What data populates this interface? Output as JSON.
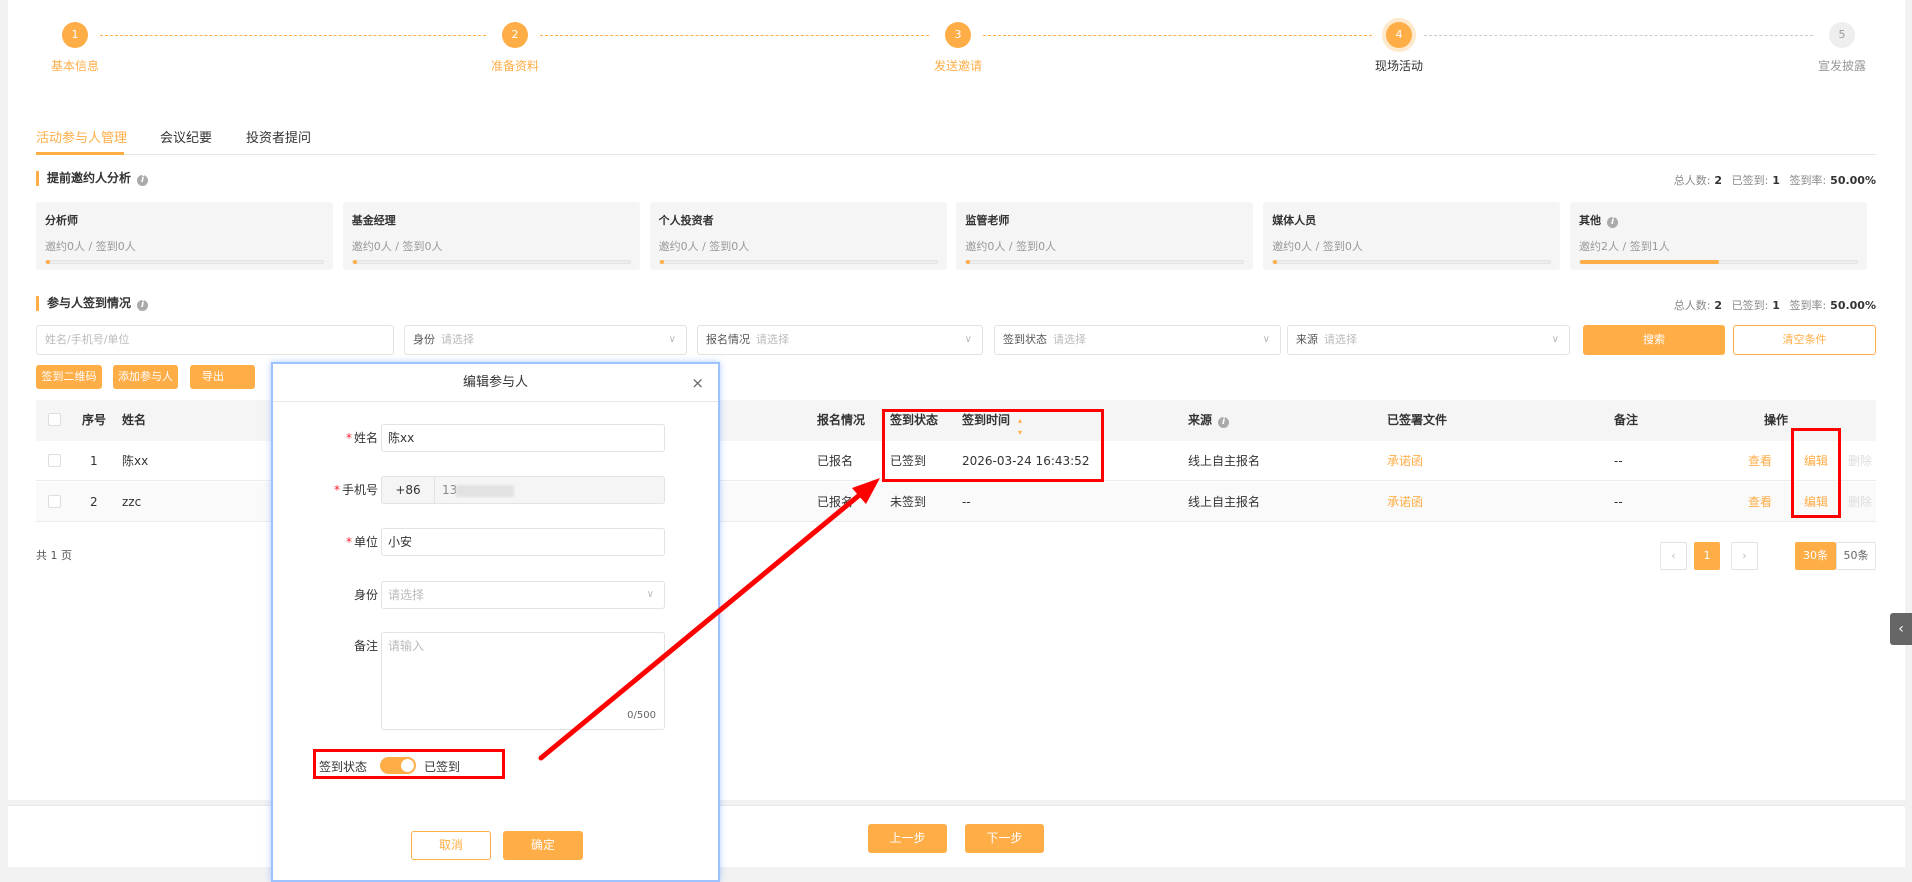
{
  "steps": [
    {
      "num": "1",
      "label": "基本信息",
      "state": "done"
    },
    {
      "num": "2",
      "label": "准备资料",
      "state": "done"
    },
    {
      "num": "3",
      "label": "发送邀请",
      "state": "done"
    },
    {
      "num": "4",
      "label": "现场活动",
      "state": "current"
    },
    {
      "num": "5",
      "label": "宣发披露",
      "state": "todo"
    }
  ],
  "tabs": [
    {
      "label": "活动参与人管理",
      "active": true
    },
    {
      "label": "会议纪要"
    },
    {
      "label": "投资者提问"
    }
  ],
  "analysis": {
    "title": "提前邀约人分析",
    "stats": {
      "total_label": "总人数:",
      "total": "2",
      "signed_label": "已签到:",
      "signed": "1",
      "rate_label": "签到率:",
      "rate": "50.00%"
    },
    "cards": [
      {
        "title": "分析师",
        "sub": "邀约0人 / 签到0人",
        "progress": 0
      },
      {
        "title": "基金经理",
        "sub": "邀约0人 / 签到0人",
        "progress": 0
      },
      {
        "title": "个人投资者",
        "sub": "邀约0人 / 签到0人",
        "progress": 0
      },
      {
        "title": "监管老师",
        "sub": "邀约0人 / 签到0人",
        "progress": 0
      },
      {
        "title": "媒体人员",
        "sub": "邀约0人 / 签到0人",
        "progress": 0
      },
      {
        "title": "其他",
        "sub": "邀约2人 / 签到1人",
        "progress": 50
      }
    ]
  },
  "checkin": {
    "title": "参与人签到情况",
    "stats": {
      "total_label": "总人数:",
      "total": "2",
      "signed_label": "已签到:",
      "signed": "1",
      "rate_label": "签到率:",
      "rate": "50.00%"
    },
    "filters": {
      "search_placeholder": "姓名/手机号/单位",
      "identity_label": "身份",
      "identity_placeholder": "请选择",
      "reg_label": "报名情况",
      "reg_placeholder": "请选择",
      "status_label": "签到状态",
      "status_placeholder": "请选择",
      "source_label": "来源",
      "source_placeholder": "请选择",
      "search_btn": "搜索",
      "clear_btn": "清空条件"
    },
    "actions": {
      "qr": "签到二维码",
      "add": "添加参与人",
      "export": "导出"
    },
    "columns": {
      "no": "序号",
      "name": "姓名",
      "reg": "报名情况",
      "status": "签到状态",
      "time": "签到时间",
      "source": "来源",
      "files": "已签署文件",
      "remark": "备注",
      "ops": "操作"
    },
    "rows": [
      {
        "no": "1",
        "name": "陈xx",
        "reg": "已报名",
        "status": "已签到",
        "time": "2026-03-24 16:43:52",
        "source": "线上自主报名",
        "file": "承诺函",
        "remark": "--"
      },
      {
        "no": "2",
        "name": "zzc",
        "reg": "已报名",
        "status": "未签到",
        "time": "--",
        "source": "线上自主报名",
        "file": "承诺函",
        "remark": "--"
      }
    ],
    "ops": {
      "view": "查看",
      "edit": "编辑",
      "delete": "删除"
    },
    "pages_text": "共 1 页",
    "pagination": {
      "prev": "‹",
      "current": "1",
      "next": "›",
      "size30": "30条",
      "size50": "50条"
    }
  },
  "modal": {
    "title": "编辑参与人",
    "name_label": "姓名",
    "name_value": "陈xx",
    "phone_label": "手机号",
    "phone_prefix": "+86",
    "phone_value": "13",
    "org_label": "单位",
    "org_value": "小安",
    "identity_label": "身份",
    "identity_placeholder": "请选择",
    "remark_label": "备注",
    "remark_placeholder": "请输入",
    "remark_count": "0/500",
    "status_label": "签到状态",
    "status_value": "已签到",
    "status_on": true,
    "cancel": "取消",
    "confirm": "确定"
  },
  "footer": {
    "prev": "上一步",
    "next": "下一步"
  },
  "colors": {
    "accent": "#ffad47",
    "annotation": "#ff0000"
  }
}
